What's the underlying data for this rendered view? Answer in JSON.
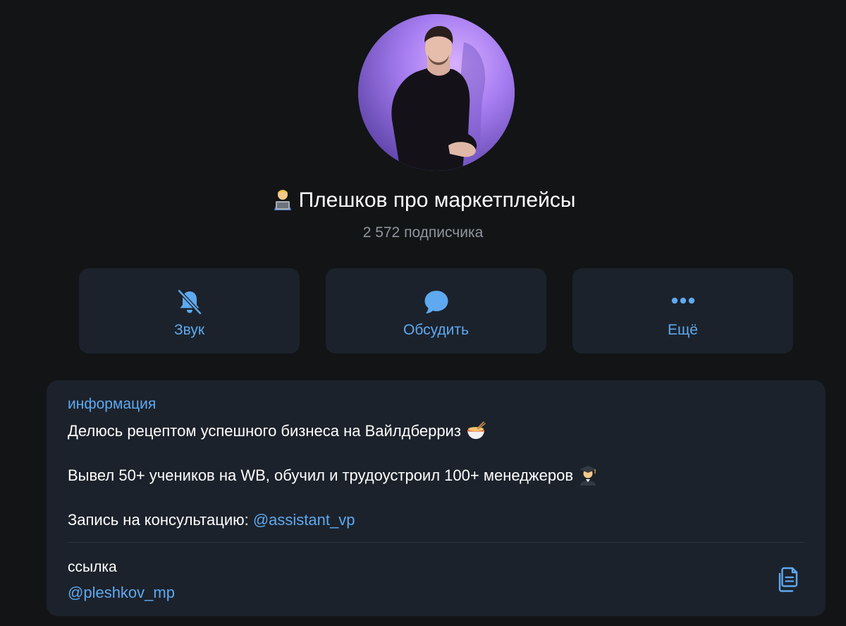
{
  "channel": {
    "title": "Плешков про маркетплейсы",
    "title_emoji_icon": "technologist-emoji",
    "subscribers": "2 572 подписчика"
  },
  "actions": [
    {
      "label": "Звук",
      "icon": "bell-muted-icon"
    },
    {
      "label": "Обсудить",
      "icon": "chat-bubble-icon"
    },
    {
      "label": "Ещё",
      "icon": "more-dots-icon"
    }
  ],
  "info": {
    "heading": "информация",
    "line1": "Делюсь рецептом успешного бизнеса на Вайлдберриз",
    "line1_emoji_icon": "noodle-bowl-emoji",
    "line2": "Вывел 50+ учеников на WB, обучил и трудоустроил 100+ менеджеров",
    "line2_emoji_icon": "graduate-emoji",
    "line3_prefix": "Запись на консультацию: ",
    "line3_link": "@assistant_vp"
  },
  "link": {
    "label": "ссылка",
    "value": "@pleshkov_mp",
    "copy_icon": "copy-icon"
  },
  "colors": {
    "background": "#131416",
    "card": "#1c222b",
    "accent": "#5ea9f0",
    "secondary_text": "#8e969e"
  }
}
